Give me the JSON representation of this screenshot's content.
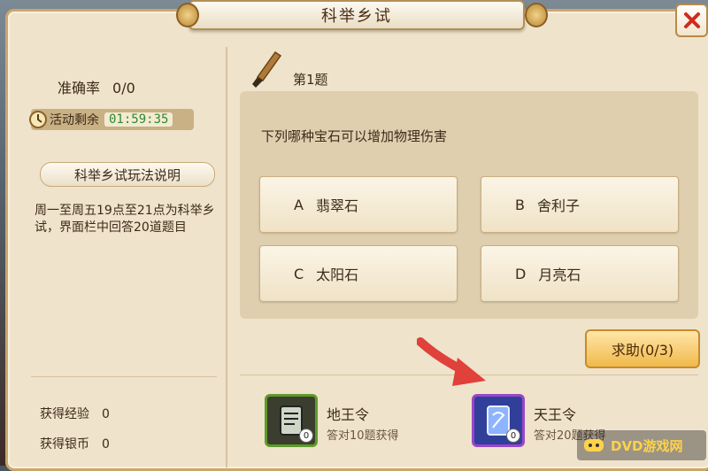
{
  "window": {
    "title": "科举乡试"
  },
  "stats": {
    "accuracy_label": "准确率",
    "accuracy_value": "0/0",
    "timer_label": "活动剩余",
    "timer_value": "01:59:35"
  },
  "rules": {
    "button_label": "科举乡试玩法说明",
    "text": "周一至周五19点至21点为科举乡试，界面栏中回答20道题目"
  },
  "rewards_summary": [
    {
      "label": "获得经验",
      "value": "0"
    },
    {
      "label": "获得银币",
      "value": "0"
    }
  ],
  "question": {
    "number_label": "第1题",
    "text": "下列哪种宝石可以增加物理伤害",
    "options": [
      {
        "letter": "A",
        "text": "翡翠石"
      },
      {
        "letter": "B",
        "text": "舍利子"
      },
      {
        "letter": "C",
        "text": "太阳石"
      },
      {
        "letter": "D",
        "text": "月亮石"
      }
    ]
  },
  "help_button": {
    "label": "求助(0/3)"
  },
  "reward_items": [
    {
      "name": "地王令",
      "desc": "答对10题获得",
      "count": "0",
      "icon": "earth-token-icon",
      "border": "#5f9a2a",
      "fill": "#3b3e2e"
    },
    {
      "name": "天王令",
      "desc": "答对20题获得",
      "count": "0",
      "icon": "heaven-token-icon",
      "border": "#9a46c8",
      "fill": "#2f3f9a"
    }
  ],
  "watermark": {
    "text": "DVD游戏网"
  },
  "colors": {
    "accent": "#f0b94b",
    "timer_green": "#2e8a2e",
    "arrow_red": "#e0413a"
  }
}
